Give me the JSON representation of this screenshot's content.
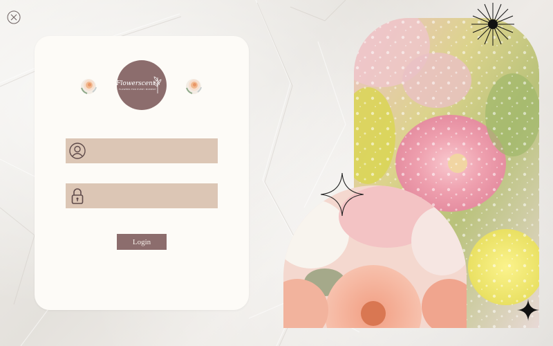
{
  "window": {
    "close_icon": "close-circle-icon"
  },
  "brand": {
    "name": "Flowerscent's",
    "tagline": "FLOWERS FOR EVERY MOMENT",
    "logo_color": "#8c6d6d",
    "decor_icon": "rose-icon"
  },
  "form": {
    "username": {
      "icon": "user-circle-icon",
      "value": "",
      "placeholder": ""
    },
    "password": {
      "icon": "lock-icon",
      "value": "",
      "placeholder": ""
    },
    "login_label": "Login",
    "field_color": "#dcc6b5"
  },
  "decor": {
    "photo_top": "pink-flowers-with-water-droplets",
    "photo_bottom": "pink-gerbera-bouquet",
    "sparkles": [
      "starburst-icon",
      "four-point-star-outline-icon",
      "four-point-star-icon"
    ]
  }
}
